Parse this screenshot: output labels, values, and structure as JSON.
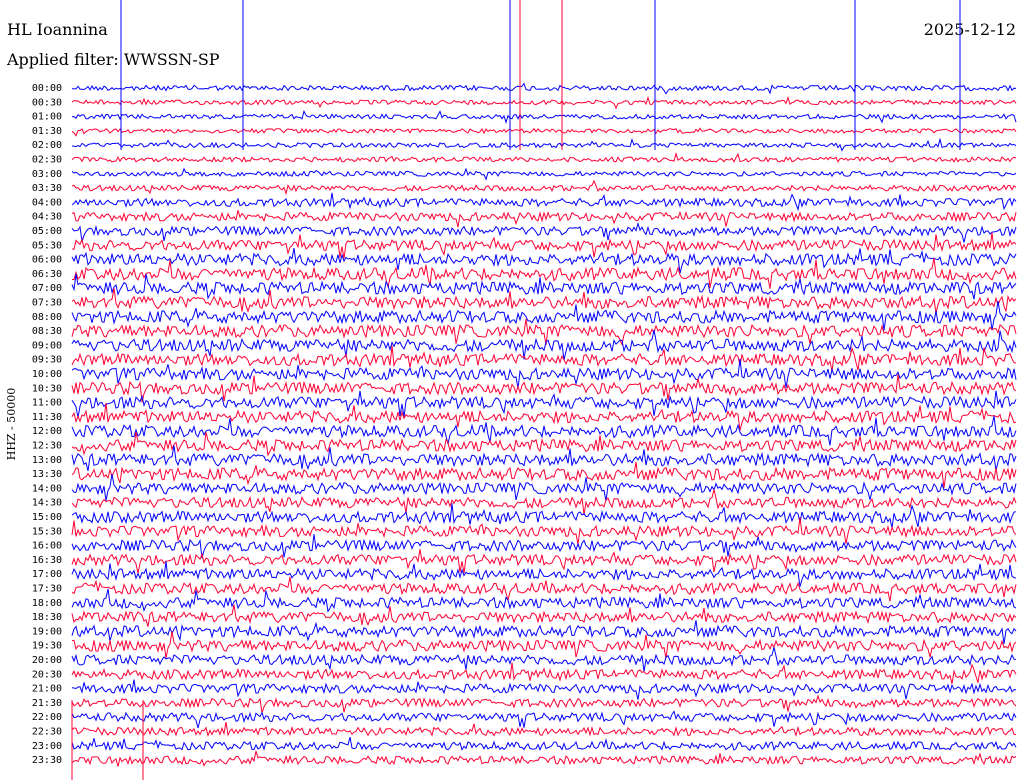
{
  "header": {
    "station": "HL Ioannina",
    "filter_prefix": "Applied filter:",
    "filter_name": "WWSSN-SP",
    "date": "2025-12-12"
  },
  "channel_label": "HHZ - 50000",
  "colors": {
    "trace_a": "#0000ff",
    "trace_b": "#ff0033",
    "background": "#ffffff",
    "text": "#000000"
  },
  "chart_data": {
    "type": "line",
    "title": "HL Ioannina",
    "subtitle": "Applied filter: WWSSN-SP",
    "date": "2025-12-12",
    "ylabel": "HHZ - 50000",
    "xlabel": "",
    "grid": false,
    "legend": "none",
    "row_labels": [
      "00:00",
      "00:30",
      "01:00",
      "01:30",
      "02:00",
      "02:30",
      "03:00",
      "03:30",
      "04:00",
      "04:30",
      "05:00",
      "05:30",
      "06:00",
      "06:30",
      "07:00",
      "07:30",
      "08:00",
      "08:30",
      "09:00",
      "09:30",
      "10:00",
      "10:30",
      "11:00",
      "11:30",
      "12:00",
      "12:30",
      "13:00",
      "13:30",
      "14:00",
      "14:30",
      "15:00",
      "15:30",
      "16:00",
      "16:30",
      "17:00",
      "17:30",
      "18:00",
      "18:30",
      "19:00",
      "19:30",
      "20:00",
      "20:30",
      "21:00",
      "21:30",
      "22:00",
      "22:30",
      "23:00",
      "23:30"
    ],
    "row_colors": [
      "blue",
      "red"
    ],
    "activity_level": [
      0.25,
      0.2,
      0.2,
      0.18,
      0.2,
      0.22,
      0.22,
      0.3,
      0.5,
      0.55,
      0.6,
      0.75,
      0.85,
      0.9,
      0.9,
      0.9,
      0.9,
      0.9,
      0.9,
      0.85,
      0.85,
      0.85,
      0.85,
      0.85,
      0.85,
      0.85,
      0.9,
      0.9,
      0.8,
      0.75,
      0.8,
      0.75,
      0.75,
      0.75,
      0.75,
      0.75,
      0.75,
      0.75,
      0.8,
      0.8,
      0.7,
      0.65,
      0.6,
      0.55,
      0.55,
      0.5,
      0.5,
      0.5
    ]
  }
}
